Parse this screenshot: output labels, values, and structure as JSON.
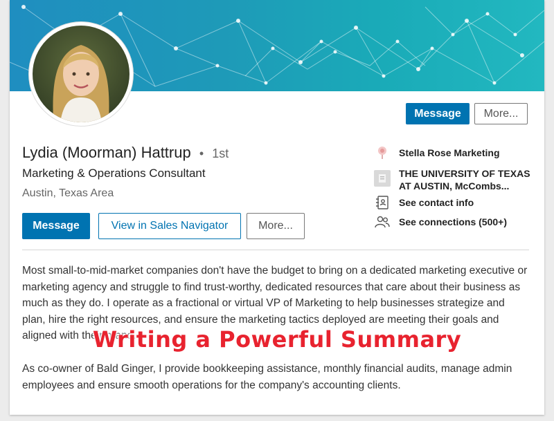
{
  "profile": {
    "name": "Lydia (Moorman) Hattrup",
    "degree_separator": "•",
    "degree": "1st",
    "headline": "Marketing & Operations Consultant",
    "location": "Austin, Texas Area"
  },
  "top_actions": {
    "message_label": "Message",
    "more_label": "More..."
  },
  "actions": {
    "message_label": "Message",
    "sales_nav_label": "View in Sales Navigator",
    "more_label": "More..."
  },
  "sidebar": {
    "company": "Stella Rose Marketing",
    "school_line1": "THE UNIVERSITY OF TEXAS",
    "school_line2": "AT AUSTIN, McCombs...",
    "contact_info": "See contact info",
    "connections": "See connections (500+)"
  },
  "summary": {
    "paragraph1": "Most small-to-mid-market companies don't have the budget to bring on a dedicated marketing executive or marketing agency and struggle to find trust-worthy, dedicated resources that care about their business as much as they do. I operate as a fractional or virtual VP of Marketing to help businesses strategize and plan, hire the right resources, and ensure the marketing tactics deployed are meeting their goals and aligned with their brand.",
    "paragraph2": "As co-owner of Bald Ginger, I provide bookkeeping assistance, monthly financial audits, manage admin employees and ensure smooth operations for the company's accounting clients."
  },
  "overlay": {
    "title": "Writing a Powerful Summary"
  },
  "colors": {
    "primary": "#0073b1",
    "overlay_red": "#e8232f",
    "banner": "#1e9ab8"
  },
  "icons": {
    "company": "rose-logo-icon",
    "school": "school-logo-icon",
    "contact": "contact-book-icon",
    "connections": "people-icon"
  }
}
